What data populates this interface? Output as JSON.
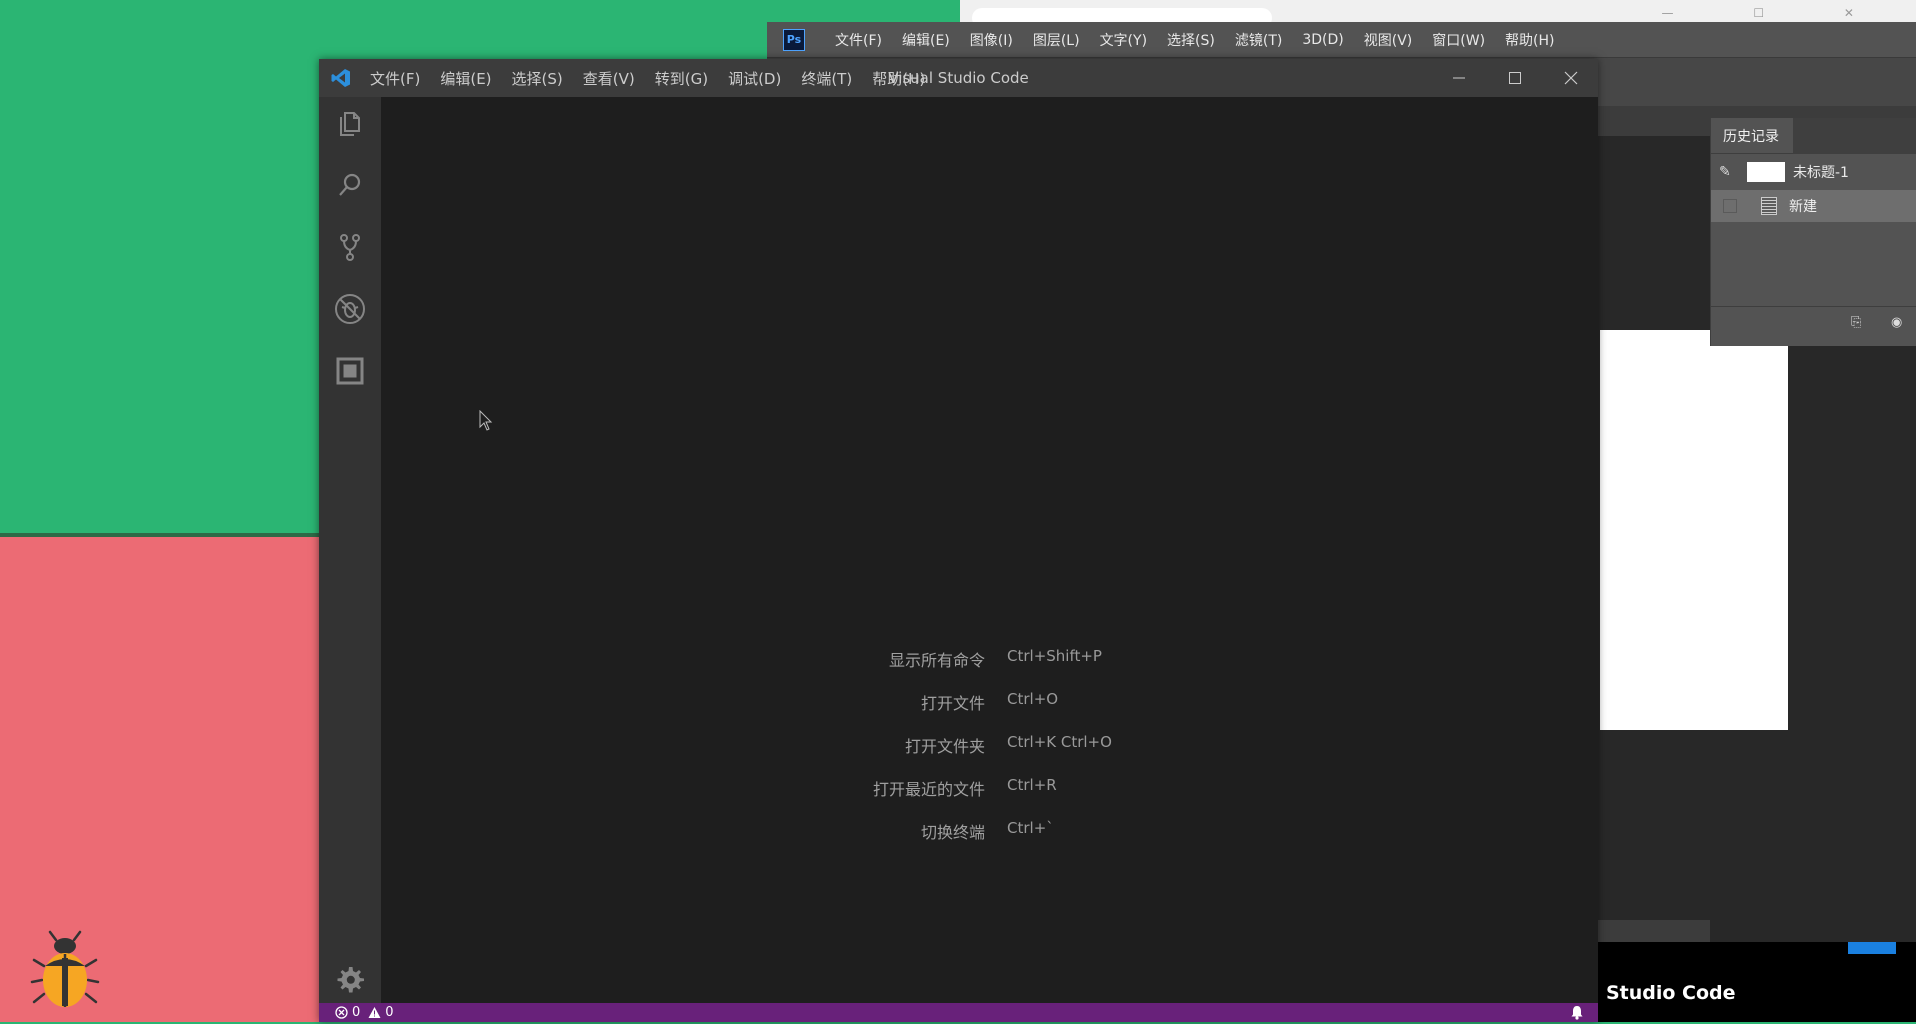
{
  "photoshop": {
    "logo": "Ps",
    "menu": [
      "文件(F)",
      "编辑(E)",
      "图像(I)",
      "图层(L)",
      "文字(Y)",
      "选择(S)",
      "滤镜(T)",
      "3D(D)",
      "视图(V)",
      "窗口(W)",
      "帮助(H)"
    ],
    "history_panel": {
      "tab": "历史记录",
      "snapshot_label": "未标题-1",
      "step_label": "新建"
    }
  },
  "taskbar": {
    "partial_text": "al Studio Code"
  },
  "vscode": {
    "menu": [
      "文件(F)",
      "编辑(E)",
      "选择(S)",
      "查看(V)",
      "转到(G)",
      "调试(D)",
      "终端(T)",
      "帮助(H)"
    ],
    "title": "Visual Studio Code",
    "activity_icons": [
      "explorer-icon",
      "search-icon",
      "source-control-icon",
      "debug-icon",
      "extensions-icon",
      "gear-icon"
    ],
    "shortcuts": [
      {
        "label": "显示所有命令",
        "keys": "Ctrl+Shift+P"
      },
      {
        "label": "打开文件",
        "keys": "Ctrl+O"
      },
      {
        "label": "打开文件夹",
        "keys": "Ctrl+K Ctrl+O"
      },
      {
        "label": "打开最近的文件",
        "keys": "Ctrl+R"
      },
      {
        "label": "切换终端",
        "keys": "Ctrl+`"
      }
    ],
    "status": {
      "errors": "0",
      "warnings": "0"
    },
    "colors": {
      "statusbar": "#68217a",
      "titlebar": "#3c3c3c",
      "activitybar": "#333333",
      "editor": "#1e1e1e"
    }
  },
  "desktop": {
    "colors": {
      "top": "#2bb573",
      "bottom": "#ec6b74"
    }
  }
}
